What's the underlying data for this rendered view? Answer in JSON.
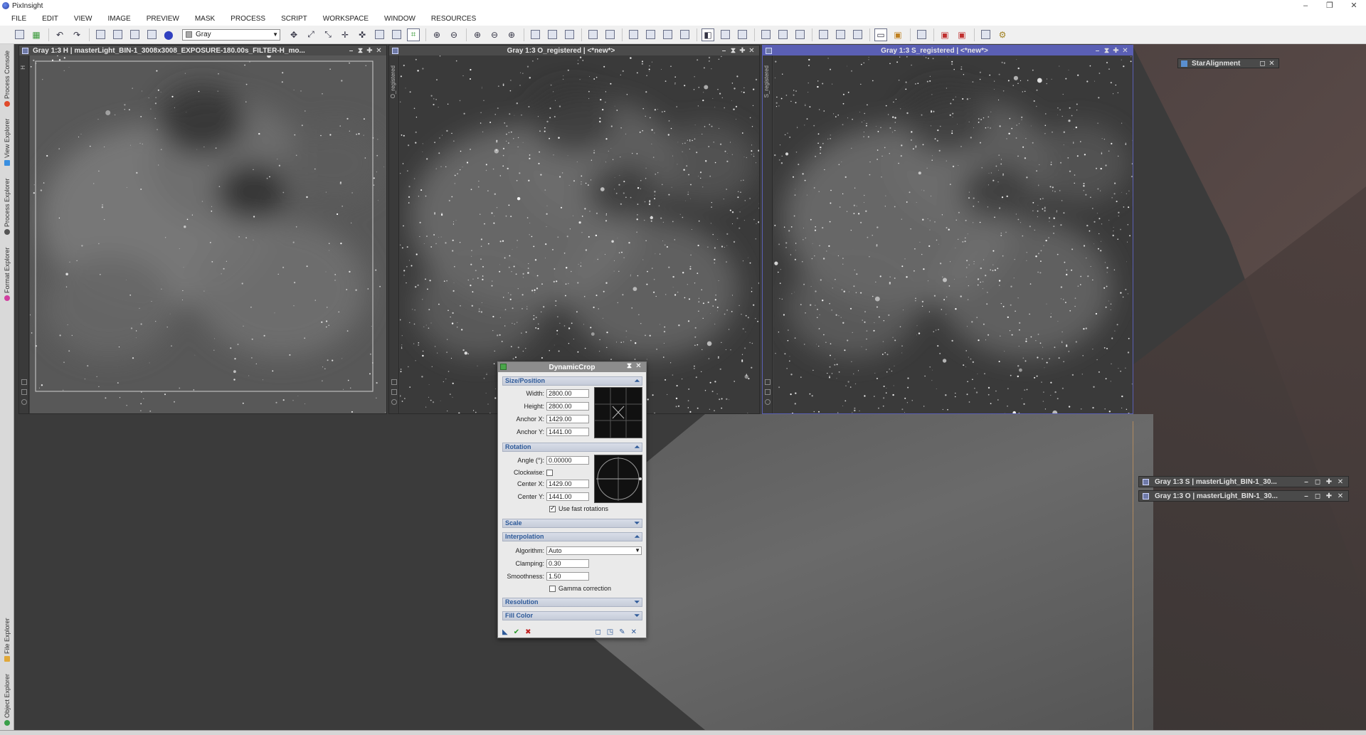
{
  "app": {
    "title": "PixInsight"
  },
  "window_controls": {
    "minimize": "–",
    "restore": "❐",
    "close": "✕"
  },
  "menu": [
    "FILE",
    "EDIT",
    "VIEW",
    "IMAGE",
    "PREVIEW",
    "MASK",
    "PROCESS",
    "SCRIPT",
    "WORKSPACE",
    "WINDOW",
    "RESOURCES"
  ],
  "toolbar": {
    "channel_select": "Gray"
  },
  "left_dock": {
    "tabs": [
      "Process Console",
      "View Explorer",
      "Process Explorer",
      "Format Explorer",
      "File Explorer",
      "Object Explorer"
    ],
    "colors": [
      "#e04a2a",
      "#3a8fe0",
      "#555555",
      "#d13fa0",
      "#e0a83a",
      "#3aa04a"
    ]
  },
  "image_windows": [
    {
      "title": "Gray 1:3 H | masterLight_BIN-1_3008x3008_EXPOSURE-180.00s_FILTER-H_mo...",
      "side_label": "H"
    },
    {
      "title": "Gray 1:3 O_registered | <*new*>",
      "side_label": "O_registered"
    },
    {
      "title": "Gray 1:3 S_registered | <*new*>",
      "side_label": "S_registered"
    }
  ],
  "dynamic_crop": {
    "title": "DynamicCrop",
    "sections": {
      "size_position": "Size/Position",
      "rotation": "Rotation",
      "scale": "Scale",
      "interpolation": "Interpolation",
      "resolution": "Resolution",
      "fill_color": "Fill Color"
    },
    "labels": {
      "width": "Width:",
      "height": "Height:",
      "anchor_x": "Anchor X:",
      "anchor_y": "Anchor Y:",
      "angle": "Angle (°):",
      "clockwise": "Clockwise:",
      "center_x": "Center X:",
      "center_y": "Center Y:",
      "use_fast_rotations": "Use fast rotations",
      "algorithm": "Algorithm:",
      "clamping": "Clamping:",
      "smoothness": "Smoothness:",
      "gamma_correction": "Gamma correction"
    },
    "values": {
      "width": "2800.00",
      "height": "2800.00",
      "anchor_x": "1429.00",
      "anchor_y": "1441.00",
      "angle": "0.00000",
      "center_x": "1429.00",
      "center_y": "1441.00",
      "algorithm": "Auto",
      "clamping": "0.30",
      "smoothness": "1.50"
    }
  },
  "star_alignment": {
    "title": "StarAlignment"
  },
  "iconified_windows": [
    "Gray 1:3 S | masterLight_BIN-1_30...",
    "Gray 1:3 O | masterLight_BIN-1_30..."
  ]
}
